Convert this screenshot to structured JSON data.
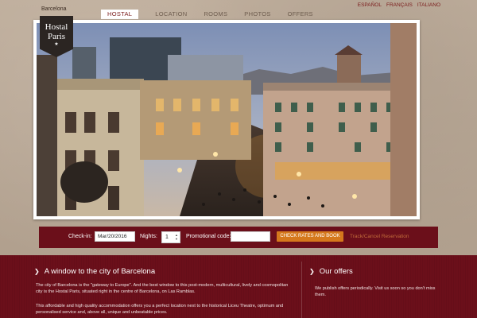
{
  "logo": {
    "city": "Barcelona",
    "line1": "Hostal",
    "line2": "Paris",
    "star": "★"
  },
  "nav": {
    "items": [
      {
        "label": "HOSTAL",
        "active": true
      },
      {
        "label": "LOCATION",
        "active": false
      },
      {
        "label": "ROOMS",
        "active": false
      },
      {
        "label": "PHOTOS",
        "active": false
      },
      {
        "label": "OFFERS",
        "active": false
      }
    ]
  },
  "languages": [
    "ESPAÑOL",
    "FRANÇAIS",
    "ITALIANO"
  ],
  "booking": {
    "checkin_label": "Check-in:",
    "checkin_value": "Mar/20/2016",
    "nights_label": "Nights:",
    "nights_value": "1",
    "promo_label": "Promotional code:",
    "promo_value": "",
    "check_button": "CHECK RATES AND BOOK",
    "track_link": "Track/Cancel Reservation"
  },
  "main": {
    "title": "A window to the city of Barcelona",
    "paragraph1": "The city of Barcelona is the \"gateway to Europe\". And the best window to this post-modern, multicultural, lively and cosmopolitan city is the Hostal Paris, situated right in the centre of Barcelona, on Las Ramblas.",
    "paragraph2": "This affordable and high quality accommodation offers you a perfect location next to the historical Liceu Theatre, optimum and personalised service and, above all, unique and unbeatable prices."
  },
  "offers": {
    "title": "Our offers",
    "text": "We publish offers periodically. Visit us soon so you don't miss them."
  },
  "colors": {
    "brand": "#6b0f1a",
    "button": "#d5781c",
    "link": "#c06a3a",
    "background": "#b8a896"
  },
  "icons": {
    "section_chevron": "chevron-right-icon"
  }
}
